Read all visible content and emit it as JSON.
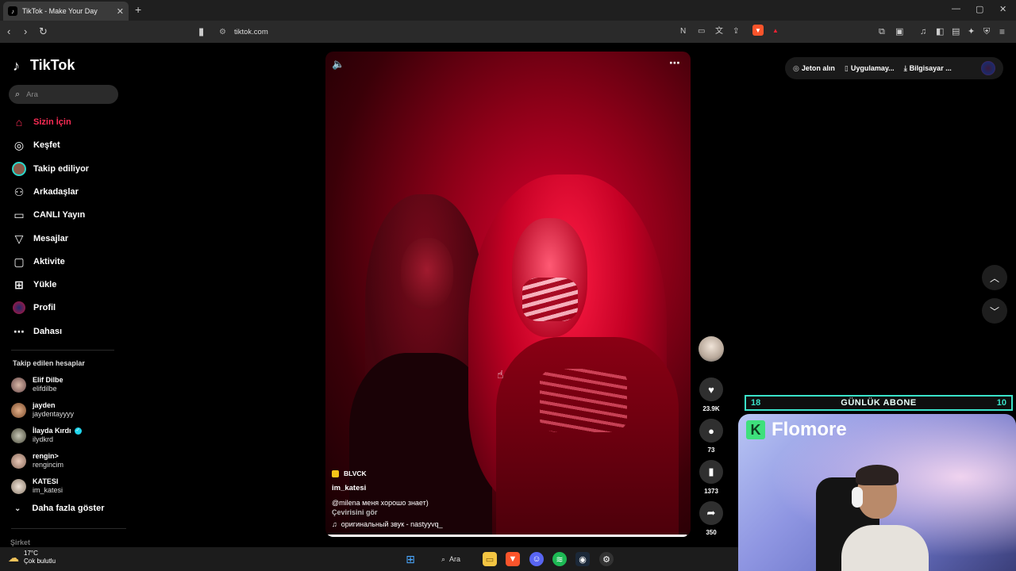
{
  "browser": {
    "tab_title": "TikTok - Make Your Day",
    "tab_close": "✕",
    "new_tab": "+",
    "url": "tiktok.com",
    "win_min": "—",
    "win_max": "▢",
    "win_close": "✕",
    "shields_count": "1"
  },
  "tiktok": {
    "logo_text": "TikTok",
    "search_placeholder": "Ara",
    "nav": [
      {
        "label": "Sizin İçin",
        "icon": "home-icon",
        "active": true
      },
      {
        "label": "Keşfet",
        "icon": "compass-icon"
      },
      {
        "label": "Takip ediliyor",
        "icon": "following-avatar-icon"
      },
      {
        "label": "Arkadaşlar",
        "icon": "friends-icon"
      },
      {
        "label": "CANLI Yayın",
        "icon": "live-tv-icon"
      },
      {
        "label": "Mesajlar",
        "icon": "send-icon"
      },
      {
        "label": "Aktivite",
        "icon": "activity-icon"
      },
      {
        "label": "Yükle",
        "icon": "upload-icon"
      },
      {
        "label": "Profil",
        "icon": "profile-avatar-icon"
      },
      {
        "label": "Dahası",
        "icon": "more-icon"
      }
    ],
    "following_title": "Takip edilen hesaplar",
    "following": [
      {
        "name": "Elif Dilbe",
        "handle": "elifdilbe",
        "verified": false
      },
      {
        "name": "jayden",
        "handle": "jaydentayyyy",
        "verified": false
      },
      {
        "name": "İlayda Kırdı",
        "handle": "ilydkrd",
        "verified": true
      },
      {
        "name": "rengin>",
        "handle": "rengincim",
        "verified": false
      },
      {
        "name": "KATESI",
        "handle": "im_katesi",
        "verified": false
      }
    ],
    "show_more": "Daha fazla göster",
    "company": "Şirket",
    "header": {
      "coins": "Jeton alın",
      "app": "Uygulamay...",
      "desktop": "Bilgisayar ..."
    }
  },
  "video": {
    "tag": "BLVCK",
    "author": "im_katesi",
    "caption": "@milena  меня хорошо знает)",
    "translate": "Çevirisini gör",
    "sound": "оригинальный звук - nastyyvq_",
    "progress": 0.99,
    "likes": "23.9K",
    "comments": "73",
    "saves": "1373",
    "shares": "350"
  },
  "overlay": {
    "abone_left": "18",
    "abone_title": "GÜNLÜK ABONE",
    "abone_right": "10",
    "brand_letter": "K",
    "brand_name": "Flomore"
  },
  "taskbar": {
    "temp": "17°C",
    "weather": "Çok bulutlu",
    "search": "Ara"
  }
}
